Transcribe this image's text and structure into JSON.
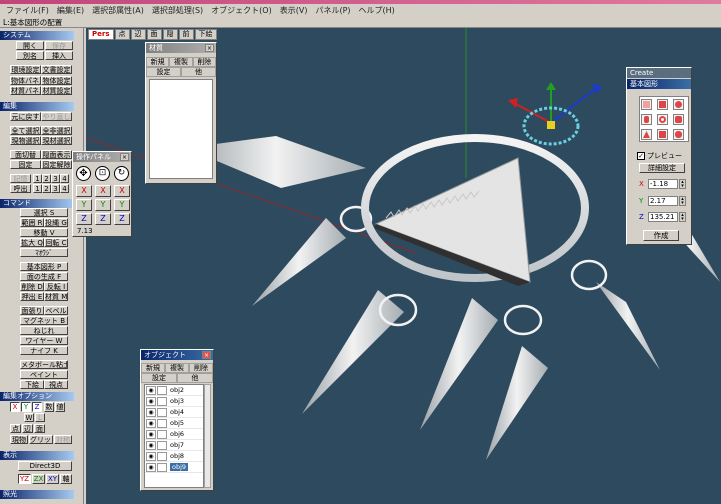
{
  "app": {
    "title_bar": ""
  },
  "menu": [
    "ファイル(F)",
    "編集(E)",
    "選択部属性(A)",
    "選択部処理(S)",
    "オブジェクト(O)",
    "表示(V)",
    "パネル(P)",
    "ヘルプ(H)"
  ],
  "toolbar": {
    "label": "L:基本図形の配置"
  },
  "system": {
    "header": "システム",
    "open": "開く",
    "save": "保存",
    "save_as": "別名",
    "insert": "挿入",
    "env_settings": "環境設定",
    "doc_settings": "文書設定",
    "object_panel": "物体パネル",
    "object_settings": "物体設定",
    "material_panel": "材質パネル",
    "material_settings": "材質設定"
  },
  "edit": {
    "header": "編集",
    "undo": "元に戻す",
    "redo": "やり直し",
    "select_all": "全て選択",
    "deselect_all": "全非選択",
    "select_current_object": "現物選択",
    "select_current_material": "現材選択",
    "face_flip": "面切替",
    "hidden_face": "隠面表示",
    "fixed": "固定",
    "unfix": "固定解除",
    "memorize": "記憶",
    "recall": "呼出",
    "slots": [
      "1",
      "2",
      "3",
      "4"
    ]
  },
  "command": {
    "header": "コマンド",
    "items": [
      "選択 S",
      "範囲 R",
      "投縄 G",
      "移動 V",
      "拡大 Q",
      "回転 C",
      "ﾏｵｳｼﾞ",
      "基本図形 P",
      "面の生成 F",
      "削除 D",
      "反転 I",
      "押出 E",
      "材質 M",
      "面張り",
      "ベベル",
      "マグネット B",
      "ねじれ",
      "ワイヤー W",
      "ナイフ K",
      "メタボール粘土",
      "ペイント",
      "下絵",
      "視点"
    ]
  },
  "edit_options": {
    "header": "編集オプション",
    "axes": [
      "X",
      "Y",
      "Z"
    ],
    "mode_labels": [
      "数",
      "値"
    ],
    "wl": [
      "W",
      "L"
    ],
    "kinds": [
      "点",
      "辺",
      "面"
    ],
    "current": "現物",
    "grid": "グリッド",
    "symmetry": "対称"
  },
  "display": {
    "header": "表示",
    "renderer": "Direct3D",
    "planes": [
      "YZ",
      "ZX",
      "XY"
    ],
    "axis": "軸"
  },
  "light": {
    "header": "照光"
  },
  "view_tabs": [
    "Pers",
    "点",
    "辺",
    "面",
    "隠",
    "前",
    "下絵"
  ],
  "material_window": {
    "title": "材質",
    "buttons": [
      "新規",
      "複製",
      "削除"
    ],
    "row2": [
      "設定",
      "他"
    ]
  },
  "op_panel": {
    "title": "操作パネル",
    "x": "X",
    "y": "Y",
    "z": "Z",
    "value": "7.13"
  },
  "create_window": {
    "tab": "Create",
    "title": "基本図形",
    "preview_label": "プレビュー",
    "detail_button": "詳細設定",
    "x_label": "X",
    "y_label": "Y",
    "z_label": "Z",
    "x_value": "-1.18",
    "y_value": "2.17",
    "z_value": "135.21",
    "create_button": "作成"
  },
  "object_window": {
    "title": "オブジェクト",
    "buttons": [
      "新規",
      "複製",
      "削除"
    ],
    "row2": [
      "設定",
      "他"
    ],
    "items": [
      "obj2",
      "obj3",
      "obj4",
      "obj5",
      "obj6",
      "obj7",
      "obj8",
      "obj9"
    ],
    "selected": "obj9"
  },
  "colors": {
    "viewport_bg": "#2e4a5f",
    "accent": "#0a246a",
    "selection": "#3a6ea5"
  },
  "icons": [
    "move-icon",
    "scale-icon",
    "rotate-icon",
    "eye-icon",
    "lock-icon",
    "close-icon",
    "checkbox-icon"
  ]
}
